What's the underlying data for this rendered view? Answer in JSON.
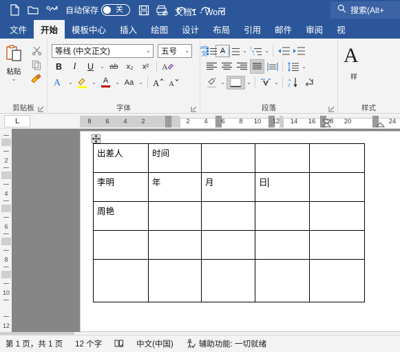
{
  "titlebar": {
    "quick_access": [
      {
        "name": "new-document-icon",
        "label": "新建"
      },
      {
        "name": "open-folder-icon",
        "label": "打开"
      },
      {
        "name": "signature-icon",
        "label": "签名"
      }
    ],
    "autosave_label": "自动保存",
    "autosave_state": "关",
    "save_label": "保存",
    "print_preview_label": "打印预览和打印",
    "undo_label": "撤消",
    "redo_label": "恢复",
    "customize_label": "自定义快速访问工具栏",
    "document_name": "文档1",
    "app_name": "Word",
    "title_separator": "-",
    "search_placeholder": "搜索(Alt+"
  },
  "tabs": [
    {
      "label": "文件",
      "active": false
    },
    {
      "label": "开始",
      "active": true
    },
    {
      "label": "模板中心",
      "active": false
    },
    {
      "label": "插入",
      "active": false
    },
    {
      "label": "绘图",
      "active": false
    },
    {
      "label": "设计",
      "active": false
    },
    {
      "label": "布局",
      "active": false
    },
    {
      "label": "引用",
      "active": false
    },
    {
      "label": "邮件",
      "active": false
    },
    {
      "label": "审阅",
      "active": false
    },
    {
      "label": "视",
      "active": false
    }
  ],
  "ribbon": {
    "clipboard": {
      "group_label": "剪贴板",
      "paste_label": "粘贴",
      "paste_caret": "⌄",
      "cut_label": "剪切",
      "copy_label": "复制",
      "format_painter_label": "格式刷"
    },
    "font": {
      "group_label": "字体",
      "font_name": "等线 (中文正文)",
      "font_size": "五号",
      "bold": "B",
      "italic": "I",
      "underline": "U",
      "strikethrough": "ab",
      "subscript": "x₂",
      "superscript": "x²",
      "clear_format": "A",
      "text_effects": "A",
      "highlight": "A",
      "font_color": "A",
      "change_case": "Aa",
      "grow_font": "A",
      "shrink_font": "A",
      "phonetic_guide": "wén 文",
      "char_border": "A",
      "char_shading": "A",
      "enclose_char": "字"
    },
    "paragraph": {
      "group_label": "段落",
      "bullets": "项目符号",
      "numbering": "编号",
      "multilevel": "多级列表",
      "decrease_indent": "减少缩进量",
      "increase_indent": "增加缩进量",
      "align_left": "左对齐",
      "align_center": "居中",
      "align_right": "右对齐",
      "justify": "两端对齐",
      "distribute": "分散对齐",
      "line_spacing": "行和段落间距",
      "shading": "底纹",
      "borders": "边框",
      "ch_align": "文本对齐",
      "sort": "排序",
      "show_marks": "显示编辑标记"
    },
    "styles": {
      "group_label": "样式",
      "style_preview": "A",
      "style_sub": "样"
    }
  },
  "ruler": {
    "tab_selector": "L",
    "h_numbers": [
      "8",
      "6",
      "4",
      "2",
      "2",
      "4",
      "6",
      "8",
      "10",
      "12",
      "14",
      "16",
      "18",
      "20",
      "24"
    ],
    "v_numbers": [
      "2",
      "4",
      "6",
      "8",
      "10",
      "12"
    ]
  },
  "document": {
    "table_move_handle": "✛",
    "table": {
      "columns": 5,
      "rows": [
        {
          "cells": [
            "出差人",
            "时间",
            "",
            "",
            ""
          ],
          "tall": false
        },
        {
          "cells": [
            "李明",
            "年",
            "月",
            "日",
            ""
          ],
          "tall": false,
          "caret_col": 3
        },
        {
          "cells": [
            "周艳",
            "",
            "",
            "",
            ""
          ],
          "tall": false
        },
        {
          "cells": [
            "",
            "",
            "",
            "",
            ""
          ],
          "tall": false
        },
        {
          "cells": [
            "",
            "",
            "",
            "",
            ""
          ],
          "tall": true
        }
      ]
    }
  },
  "statusbar": {
    "page_info": "第 1 页，共 1 页",
    "word_count": "12 个字",
    "proofing_icon_label": "校对",
    "language": "中文(中国)",
    "accessibility": "辅助功能: 一切就绪"
  },
  "colors": {
    "brand_blue": "#2b579a",
    "ribbon_bg": "#f3f3f3",
    "canvas_gray": "#868686",
    "accent_icon_blue": "#2b7cd3",
    "highlight_yellow": "#ffff00",
    "font_color_red": "#c00000"
  }
}
